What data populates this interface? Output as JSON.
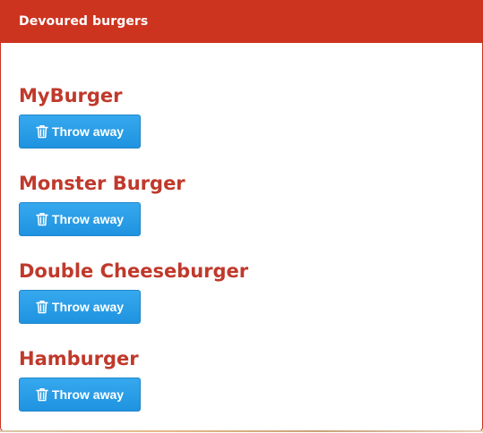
{
  "panel": {
    "heading": "Devoured burgers"
  },
  "burgers": [
    {
      "name": "MyBurger",
      "action_label": "Throw away",
      "action_icon": "trash-icon"
    },
    {
      "name": "Monster Burger",
      "action_label": "Throw away",
      "action_icon": "trash-icon"
    },
    {
      "name": "Double Cheeseburger",
      "action_label": "Throw away",
      "action_icon": "trash-icon"
    },
    {
      "name": "Hamburger",
      "action_label": "Throw away",
      "action_icon": "trash-icon"
    }
  ],
  "colors": {
    "header_bg": "#cd3420",
    "header_text": "#ffffff",
    "burger_name": "#c0392b",
    "button_bg": "#2b9ee9",
    "button_text": "#ffffff"
  }
}
